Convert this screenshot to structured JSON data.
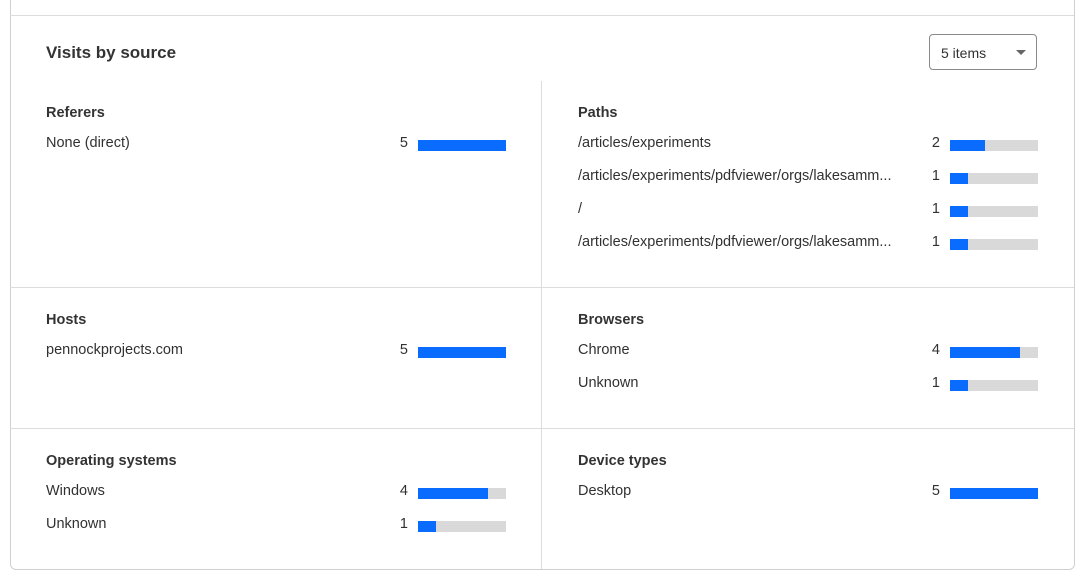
{
  "title": "Visits by source",
  "items_select": {
    "value": "5 items"
  },
  "colors": {
    "bar_fill": "#0a6cff",
    "bar_track": "#d9d9d9"
  },
  "sections": [
    {
      "heading": "Referers",
      "max": 5,
      "rows": [
        {
          "label": "None (direct)",
          "count": 5
        }
      ]
    },
    {
      "heading": "Paths",
      "max": 5,
      "rows": [
        {
          "label": "/articles/experiments",
          "count": 2
        },
        {
          "label": "/articles/experiments/pdfviewer/orgs/lakesamm...",
          "count": 1
        },
        {
          "label": "/",
          "count": 1
        },
        {
          "label": "/articles/experiments/pdfviewer/orgs/lakesamm...",
          "count": 1
        }
      ]
    },
    {
      "heading": "Hosts",
      "max": 5,
      "rows": [
        {
          "label": "pennockprojects.com",
          "count": 5
        }
      ]
    },
    {
      "heading": "Browsers",
      "max": 5,
      "rows": [
        {
          "label": "Chrome",
          "count": 4
        },
        {
          "label": "Unknown",
          "count": 1
        }
      ]
    },
    {
      "heading": "Operating systems",
      "max": 5,
      "rows": [
        {
          "label": "Windows",
          "count": 4
        },
        {
          "label": "Unknown",
          "count": 1
        }
      ]
    },
    {
      "heading": "Device types",
      "max": 5,
      "rows": [
        {
          "label": "Desktop",
          "count": 5
        }
      ]
    }
  ]
}
